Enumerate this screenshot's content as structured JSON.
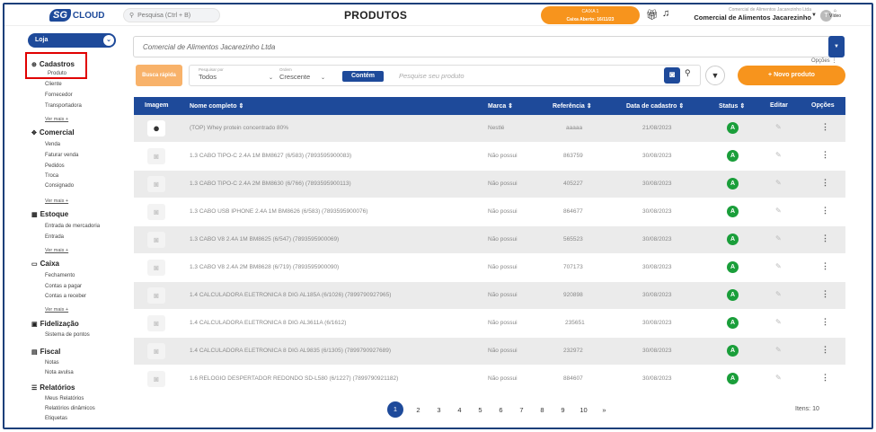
{
  "topbar": {
    "logo_badge": "SG",
    "logo_text": "CLOUD",
    "search_placeholder": "Pesquisa (Ctrl + B)",
    "title": "PRODUTOS",
    "caixa_label": "CAIXA 1",
    "caixa_status": "Caixa Aberto: 16/11/23",
    "company_small": "Comercial de Alimentos Jacarezinho Ltda",
    "company_name": "Comercial de Alimentos Jacarezinho",
    "avatar_initial": "T",
    "video_label": "Vídeo"
  },
  "sidebar": {
    "store_button": "Loja",
    "sections": [
      {
        "title": "Cadastros",
        "items": [
          "Produto",
          "Cliente",
          "Fornecedor",
          "Transportadora"
        ],
        "more": "Ver mais +"
      },
      {
        "title": "Comercial",
        "items": [
          "Venda",
          "Faturar venda",
          "Pedidos",
          "Troca",
          "Consignado"
        ],
        "more": "Ver mais +"
      },
      {
        "title": "Estoque",
        "items": [
          "Entrada de mercadoria",
          "Entrada"
        ],
        "more": "Ver mais +"
      },
      {
        "title": "Caixa",
        "items": [
          "Fechamento",
          "Contas a pagar",
          "Contas a receber"
        ],
        "more": "Ver mais +"
      },
      {
        "title": "Fidelização",
        "items": [
          "Sistema de pontos"
        ]
      },
      {
        "title": "Fiscal",
        "items": [
          "Notas",
          "Nota avulsa"
        ]
      },
      {
        "title": "Relatórios",
        "items": [
          "Meus Relatórios",
          "Relatórios dinâmicos",
          "Etiquetas"
        ]
      }
    ]
  },
  "main": {
    "company_select": "Comercial de Alimentos Jacarezinho Ltda",
    "options_label": "Opções",
    "quick_search": "Busca rápida",
    "filter_by_caption": "Pesquisar por",
    "filter_by_value": "Todos",
    "order_caption": "Ordem",
    "order_value": "Crescente",
    "match_button": "Contém",
    "search_placeholder": "Pesquise seu produto",
    "new_product": "+ Novo produto"
  },
  "table": {
    "headers": {
      "image": "Imagem",
      "name": "Nome completo ⇕",
      "brand": "Marca ⇕",
      "ref": "Referência ⇕",
      "date": "Data de cadastro ⇕",
      "status": "Status ⇕",
      "edit": "Editar",
      "options": "Opções"
    },
    "rows": [
      {
        "name": "(TOP) Whey protein concentrado 80%",
        "brand": "Nestlé",
        "ref": "aaaaa",
        "date": "21/08/2023",
        "status": "A"
      },
      {
        "name": "1.3 CABO TIPO-C 2.4A 1M BM8627 (6/583) (7893595900083)",
        "brand": "Não possui",
        "ref": "863759",
        "date": "30/08/2023",
        "status": "A"
      },
      {
        "name": "1.3 CABO TIPO-C 2.4A 2M BM8630 (6/766) (7893595900113)",
        "brand": "Não possui",
        "ref": "405227",
        "date": "30/08/2023",
        "status": "A"
      },
      {
        "name": "1.3 CABO USB IPHONE 2.4A 1M BM8626 (6/583) (7893595900076)",
        "brand": "Não possui",
        "ref": "864677",
        "date": "30/08/2023",
        "status": "A"
      },
      {
        "name": "1.3 CABO V8 2.4A 1M BM8625 (6/547) (7893595900069)",
        "brand": "Não possui",
        "ref": "565523",
        "date": "30/08/2023",
        "status": "A"
      },
      {
        "name": "1.3 CABO V8 2.4A 2M BM8628 (6/719) (7893595900090)",
        "brand": "Não possui",
        "ref": "707173",
        "date": "30/08/2023",
        "status": "A"
      },
      {
        "name": "1.4 CALCULADORA ELETRONICA 8 DIG AL185A (6/1026) (7899790927965)",
        "brand": "Não possui",
        "ref": "920898",
        "date": "30/08/2023",
        "status": "A"
      },
      {
        "name": "1.4 CALCULADORA ELETRONICA 8 DIG AL3611A (6/1612)",
        "brand": "Não possui",
        "ref": "235651",
        "date": "30/08/2023",
        "status": "A"
      },
      {
        "name": "1.4 CALCULADORA ELETRONICA 8 DIG AL9835 (6/1305) (7899790927689)",
        "brand": "Não possui",
        "ref": "232972",
        "date": "30/08/2023",
        "status": "A"
      },
      {
        "name": "1.6 RELOGIO DESPERTADOR REDONDO SD-L580 (6/1227) (7899790921182)",
        "brand": "Não possui",
        "ref": "884607",
        "date": "30/08/2023",
        "status": "A"
      }
    ]
  },
  "pagination": {
    "pages": [
      "1",
      "2",
      "3",
      "4",
      "5",
      "6",
      "7",
      "8",
      "9",
      "10"
    ],
    "next": "»",
    "items_label": "Itens:",
    "items_value": "10"
  },
  "colors": {
    "brand": "#1e4a9a",
    "accent": "#f7941d",
    "status_active": "#1a9e3a",
    "highlight": "#e00000"
  }
}
